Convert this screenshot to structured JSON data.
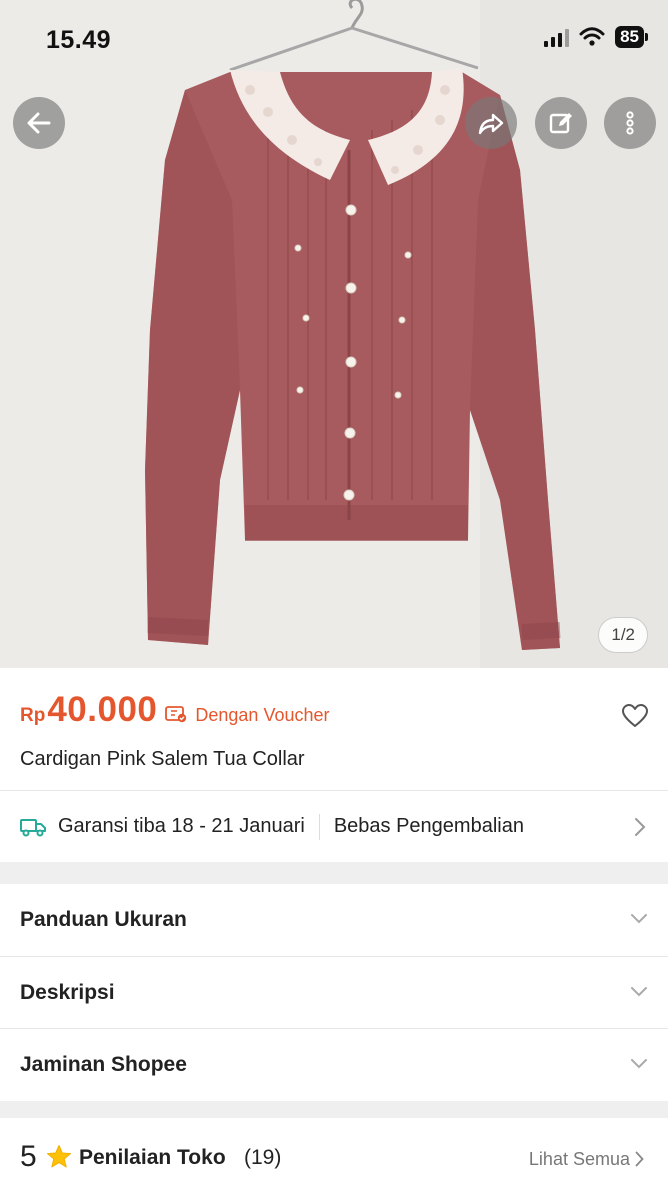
{
  "status_bar": {
    "time": "15.49",
    "battery": "85"
  },
  "gallery": {
    "counter": "1/2",
    "image_subject": "cardigan-photo"
  },
  "icons": {
    "back": "back-arrow-icon",
    "share": "share-icon",
    "edit": "edit-icon",
    "more": "more-vertical-icon",
    "wishlist": "heart-icon",
    "shipping": "truck-icon",
    "voucher": "voucher-icon",
    "star": "star-icon"
  },
  "product": {
    "price_currency": "Rp",
    "price_value": "40.000",
    "voucher_label": "Dengan Voucher",
    "title": "Cardigan Pink Salem Tua Collar"
  },
  "delivery": {
    "guarantee": "Garansi tiba 18 - 21 Januari",
    "returns": "Bebas Pengembalian"
  },
  "sections": [
    {
      "label": "Panduan Ukuran"
    },
    {
      "label": "Deskripsi"
    },
    {
      "label": "Jaminan Shopee"
    }
  ],
  "shop_rating": {
    "score": "5",
    "label": "Penilaian Toko",
    "count": "(19)",
    "see_all": "Lihat Semua"
  },
  "colors": {
    "accent": "#e4572e",
    "shipping_icon": "#26aa99",
    "star": "#ffc107",
    "cardigan": "#a85b5e",
    "collar": "#f4ebe6"
  }
}
